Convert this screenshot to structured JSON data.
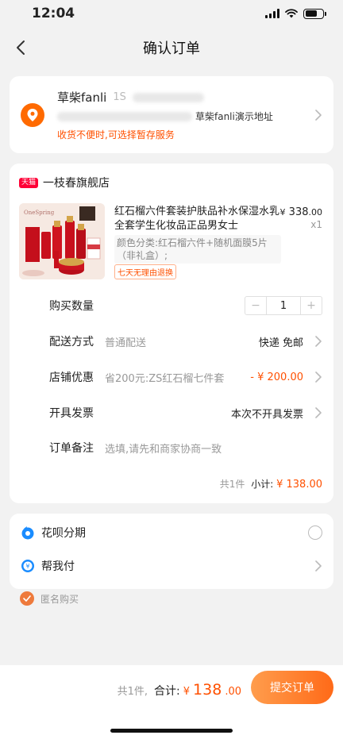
{
  "status": {
    "time": "12:04"
  },
  "nav": {
    "title": "确认订单"
  },
  "address": {
    "name": "草柴fanli",
    "phone_prefix": "1S",
    "detail_suffix": "草柴fanli演示地址",
    "hint": "收货不便时,可选择暂存服务"
  },
  "shop": {
    "badge": "天猫",
    "name": "一枝春旗舰店",
    "product": {
      "title": "红石榴六件套装护肤品补水保湿水乳全套学生化妆品正品男女士",
      "spec": "颜色分类:红石榴六件+随机面膜5片（非礼盒）;",
      "return_badge": "七天无理由退换",
      "price_currency": "¥",
      "price_int": "338",
      "price_dec": ".00",
      "quantity": "x1"
    },
    "rows": {
      "quantity_label": "购买数量",
      "quantity_minus": "−",
      "quantity_value": "1",
      "quantity_plus": "+",
      "delivery_label": "配送方式",
      "delivery_sub": "普通配送",
      "delivery_value": "快递 免邮",
      "discount_label": "店铺优惠",
      "discount_sub": "省200元:ZS红石榴七件套",
      "discount_value": "- ¥ 200.00",
      "invoice_label": "开具发票",
      "invoice_value": "本次不开具发票",
      "remark_label": "订单备注",
      "remark_placeholder": "选填,请先和商家协商一致"
    },
    "subtotal": {
      "count": "共1件",
      "label": "小计:",
      "amount": "¥ 138.00"
    }
  },
  "payment": {
    "huabei_label": "花呗分期",
    "helpme_label": "帮我付"
  },
  "anonymous": {
    "label": "匿名购买"
  },
  "bottom": {
    "count": "共1件,",
    "total_label": "合计:",
    "currency": "¥",
    "amount_int": "138",
    "amount_dec": ".00",
    "submit_label": "提交订单"
  },
  "colors": {
    "accent": "#ff5000",
    "button_start": "#ff9d4d",
    "button_end": "#ff6a18",
    "tmall": "#ff0036",
    "alipay_blue": "#1a8cff"
  },
  "icons": {
    "back": "chevron-left-icon",
    "location": "location-pin-icon",
    "chevron": "chevron-right-icon",
    "huabei": "huabei-icon",
    "helpme": "help-pay-icon",
    "anonymous": "check-circle-icon"
  }
}
